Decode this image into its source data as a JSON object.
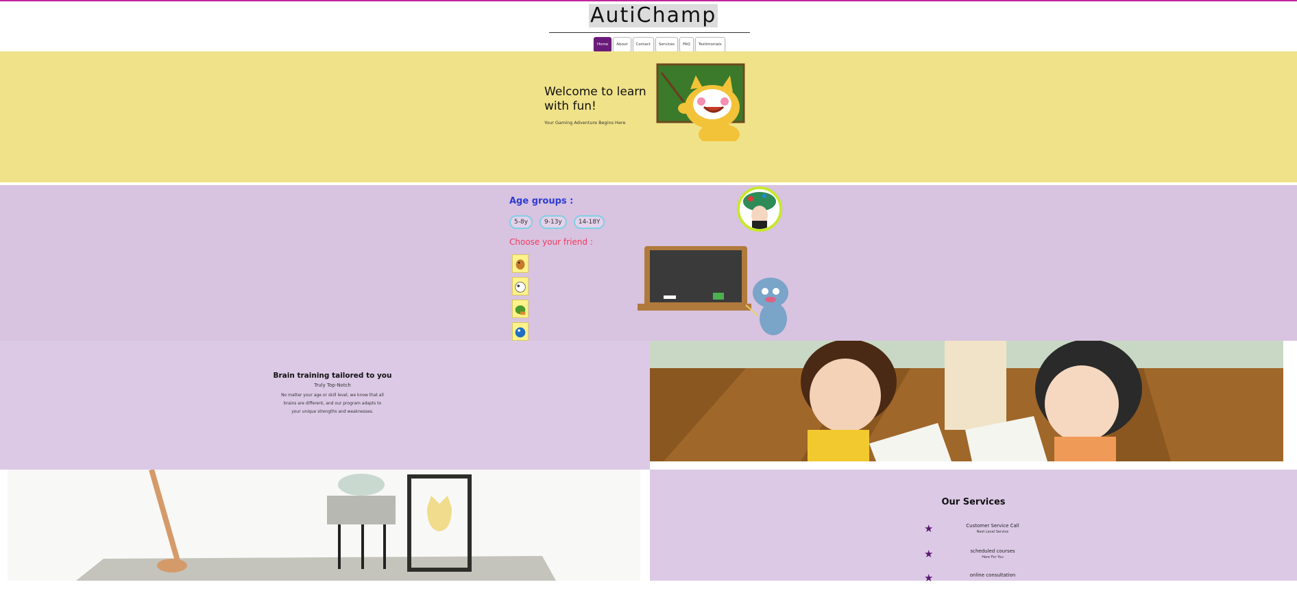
{
  "header": {
    "brand": "AutiChamp",
    "nav": [
      {
        "label": "Home",
        "active": true
      },
      {
        "label": "About",
        "active": false
      },
      {
        "label": "Contact",
        "active": false
      },
      {
        "label": "Services",
        "active": false
      },
      {
        "label": "FAQ",
        "active": false
      },
      {
        "label": "Testimonials",
        "active": false
      }
    ]
  },
  "hero": {
    "title": "Welcome to learn with fun!",
    "subtitle": "Your Gaming Adventure Begins Here"
  },
  "age_section": {
    "label": "Age groups :",
    "groups": [
      "5-8y",
      "9-13y",
      "14-18Y"
    ],
    "friend_label": "Choose your friend :",
    "friends": [
      "dog-friend",
      "cow-friend",
      "turtle-friend",
      "bird-friend"
    ]
  },
  "brain": {
    "title": "Brain training tailored to you",
    "subtitle": "Truly Top-Notch",
    "body": "No matter your age or skill level, we know that all brains are different, and our program adapts to your unique strengths and weaknesses."
  },
  "services": {
    "title": "Our Services",
    "items": [
      {
        "name": "Customer Service Call",
        "note": "Next Level Service"
      },
      {
        "name": "scheduled courses",
        "note": "Here For You"
      },
      {
        "name": "online consultation",
        "note": ""
      }
    ]
  },
  "colors": {
    "accent": "#6a1b7a",
    "hero_bg": "#f0e289",
    "section_bg": "#d8c3e0",
    "age_label": "#2d3bd1",
    "friend_label": "#ee3b5c"
  }
}
